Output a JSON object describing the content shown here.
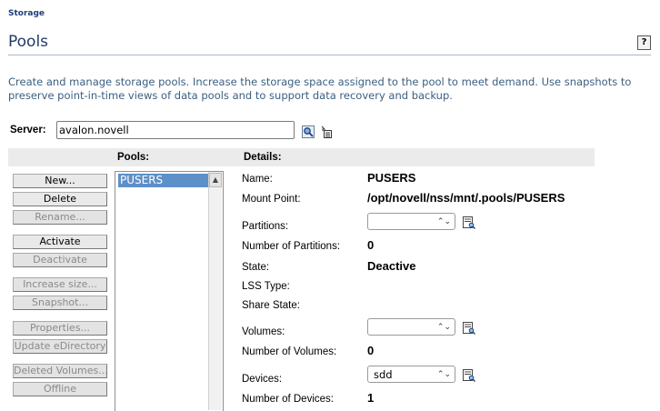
{
  "breadcrumb": "Storage",
  "page_title": "Pools",
  "help_label": "?",
  "description": "Create and manage storage pools. Increase the storage space assigned to the pool to meet demand. Use snapshots to preserve point-in-time views of data pools and to support data recovery and backup.",
  "server": {
    "label": "Server:",
    "value": "avalon.novell"
  },
  "headers": {
    "pools": "Pools:",
    "details": "Details:"
  },
  "actions": [
    {
      "label": "New...",
      "enabled": true
    },
    {
      "label": "Delete",
      "enabled": true
    },
    {
      "label": "Rename...",
      "enabled": false
    },
    {
      "label": "Activate",
      "enabled": true
    },
    {
      "label": "Deactivate",
      "enabled": false
    },
    {
      "label": "Increase size...",
      "enabled": false
    },
    {
      "label": "Snapshot...",
      "enabled": false
    },
    {
      "label": "Properties...",
      "enabled": false
    },
    {
      "label": "Update eDirectory",
      "enabled": false
    },
    {
      "label": "Deleted Volumes...",
      "enabled": false
    },
    {
      "label": "Offline",
      "enabled": false
    }
  ],
  "pools": [
    "PUSERS"
  ],
  "details": {
    "name": {
      "label": "Name:",
      "value": "PUSERS"
    },
    "mount_point": {
      "label": "Mount Point:",
      "value": "/opt/novell/nss/mnt/.pools/PUSERS"
    },
    "partitions": {
      "label": "Partitions:",
      "selected": ""
    },
    "num_partitions": {
      "label": "Number of Partitions:",
      "value": "0"
    },
    "state": {
      "label": "State:",
      "value": "Deactive"
    },
    "lss_type": {
      "label": "LSS Type:",
      "value": ""
    },
    "share_state": {
      "label": "Share State:",
      "value": ""
    },
    "volumes": {
      "label": "Volumes:",
      "selected": ""
    },
    "num_volumes": {
      "label": "Number of Volumes:",
      "value": "0"
    },
    "devices": {
      "label": "Devices:",
      "selected": "sdd"
    },
    "num_devices": {
      "label": "Number of Devices:",
      "value": "1"
    }
  }
}
